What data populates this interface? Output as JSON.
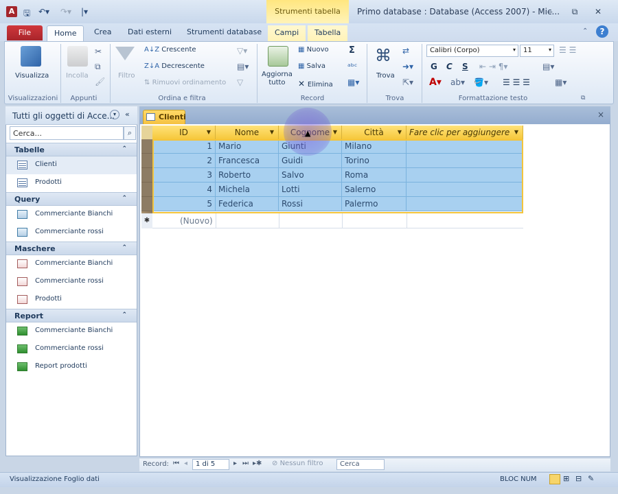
{
  "title": {
    "app_icon": "A",
    "context_band": "Strumenti tabella",
    "window_title": "Primo database : Database (Access 2007) - Mic...",
    "controls": [
      "‒",
      "⧉",
      "✕"
    ]
  },
  "tabs": {
    "file": "File",
    "items": [
      "Home",
      "Crea",
      "Dati esterni",
      "Strumenti database"
    ],
    "context": [
      "Campi",
      "Tabella"
    ],
    "active": "Home"
  },
  "ribbon": {
    "visualizzazioni": {
      "button": "Visualizza",
      "label": "Visualizzazioni"
    },
    "appunti": {
      "paste": "Incolla",
      "label": "Appunti"
    },
    "ordina": {
      "filtro": "Filtro",
      "crescente": "Crescente",
      "decrescente": "Decrescente",
      "rimuovi": "Rimuovi ordinamento",
      "label": "Ordina e filtra"
    },
    "record": {
      "aggiorna": "Aggiorna\ntutto",
      "nuovo": "Nuovo",
      "salva": "Salva",
      "elimina": "Elimina",
      "label": "Record"
    },
    "trova": {
      "button": "Trova",
      "label": "Trova"
    },
    "formattazione": {
      "font": "Calibri (Corpo)",
      "size": "11",
      "bold": "G",
      "italic": "C",
      "underline": "S",
      "label": "Formattazione testo"
    }
  },
  "nav": {
    "title": "Tutti gli oggetti di Acce...",
    "search_placeholder": "Cerca...",
    "groups": [
      {
        "name": "Tabelle",
        "items": [
          "Clienti",
          "Prodotti"
        ]
      },
      {
        "name": "Query",
        "items": [
          "Commerciante Bianchi",
          "Commerciante rossi"
        ]
      },
      {
        "name": "Maschere",
        "items": [
          "Commerciante Bianchi",
          "Commerciante rossi",
          "Prodotti"
        ]
      },
      {
        "name": "Report",
        "items": [
          "Commerciante Bianchi",
          "Commerciante rossi",
          "Report prodotti"
        ]
      }
    ]
  },
  "document": {
    "tab": "Clienti",
    "close": "×",
    "columns": [
      "ID",
      "Nome",
      "Cognome",
      "Città",
      "Fare clic per aggiungere"
    ],
    "rows": [
      [
        "1",
        "Mario",
        "Giunti",
        "Milano"
      ],
      [
        "2",
        "Francesca",
        "Guidi",
        "Torino"
      ],
      [
        "3",
        "Roberto",
        "Salvo",
        "Roma"
      ],
      [
        "4",
        "Michela",
        "Lotti",
        "Salerno"
      ],
      [
        "5",
        "Federica",
        "Rossi",
        "Palermo"
      ]
    ],
    "new_row": "(Nuovo)",
    "new_row_marker": "✱"
  },
  "recnav": {
    "label": "Record:",
    "position": "1 di 5",
    "filter": "Nessun filtro",
    "search": "Cerca"
  },
  "status": {
    "left": "Visualizzazione Foglio dati",
    "numlock": "BLOC NUM"
  }
}
